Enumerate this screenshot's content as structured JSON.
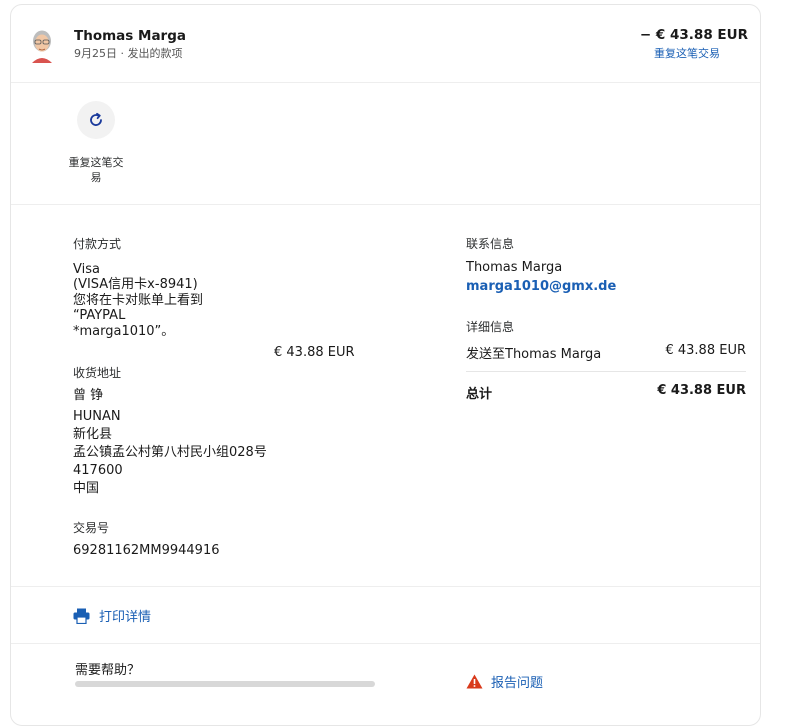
{
  "header": {
    "name": "Thomas Marga",
    "subtitle": "9月25日 · 发出的款项",
    "amount": "− € 43.88 EUR",
    "repeat_link": "重复这笔交易"
  },
  "actions": {
    "repeat_label": "重复这笔交易"
  },
  "payment": {
    "title": "付款方式",
    "method": "Visa",
    "card": "(VISA信用卡x-8941)",
    "note_line1": "您将在卡对账单上看到",
    "note_line2": "“PAYPAL",
    "note_line3": "*marga1010”。",
    "amount": "€ 43.88 EUR"
  },
  "shipping": {
    "title": "收货地址",
    "name": "曾 铮",
    "line1": "HUNAN",
    "line2": "新化县",
    "line3": "孟公镇孟公村第八村民小组028号",
    "postcode": "417600",
    "country": "中国"
  },
  "transaction": {
    "title": "交易号",
    "id": "69281162MM9944916"
  },
  "contact": {
    "title": "联系信息",
    "name": "Thomas Marga",
    "email": "marga1010@gmx.de"
  },
  "details": {
    "title": "详细信息",
    "sent_to_label": "发送至Thomas Marga",
    "sent_to_amount": "€ 43.88 EUR",
    "total_label": "总计",
    "total_amount": "€ 43.88 EUR"
  },
  "footer": {
    "print_label": "打印详情",
    "help_title": "需要帮助？",
    "report_label": "报告问题"
  },
  "colors": {
    "link": "#1a5fb4",
    "text": "#1a1a1a",
    "warning": "#d93a1b"
  }
}
